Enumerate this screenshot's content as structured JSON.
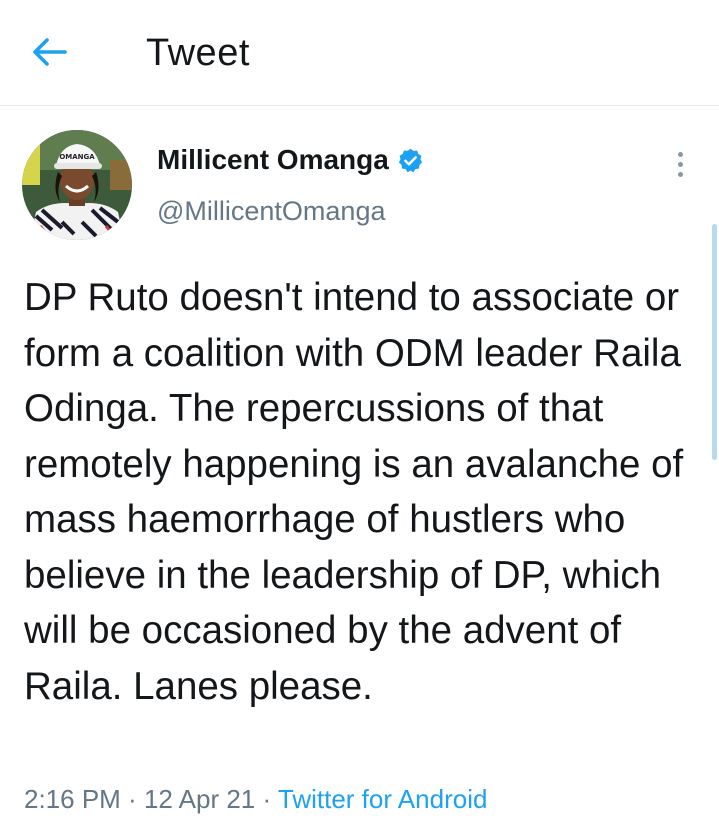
{
  "header": {
    "back_icon": "arrow-left-icon",
    "title": "Tweet"
  },
  "colors": {
    "accent": "#1da1f2",
    "secondary_text": "#657786",
    "primary_text": "#14171a"
  },
  "tweet": {
    "author": {
      "display_name": "Millicent Omanga",
      "verified": true,
      "verified_icon": "verified-badge-icon",
      "handle": "@MillicentOmanga",
      "avatar_cap_text": "OMANGA"
    },
    "menu_icon": "more-vertical-icon",
    "text": "DP Ruto doesn't intend to associate or form a coalition with ODM leader Raila Odinga. The repercussions of that remotely happening is an avalanche of mass haemorrhage of hustlers who believe in the leadership of DP, which will be occasioned by the advent of Raila. Lanes please.",
    "time": "2:16 PM",
    "separator": " · ",
    "date": "12 Apr 21",
    "source": "Twitter for Android"
  }
}
